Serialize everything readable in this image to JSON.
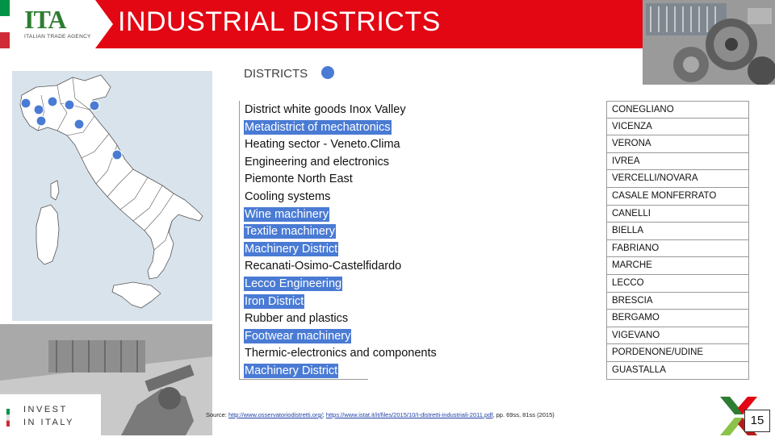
{
  "header": {
    "logo_main": "ITA",
    "logo_sub": "ITALIAN TRADE AGENCY",
    "title": "INDUSTRIAL DISTRICTS"
  },
  "legend": {
    "label": "DISTRICTS",
    "dot_color": "#4a7bd4"
  },
  "table": {
    "rows": [
      {
        "district": "District white goods Inox Valley",
        "city": "CONEGLIANO",
        "highlight": false
      },
      {
        "district": "Metadistrict of mechatronics",
        "city": "VICENZA",
        "highlight": true
      },
      {
        "district": "Heating sector - Veneto.Clima",
        "city": "VERONA",
        "highlight": false
      },
      {
        "district": "Engineering and electronics",
        "city": "IVREA",
        "highlight": false
      },
      {
        "district": "Piemonte North East",
        "city": "VERCELLI/NOVARA",
        "highlight": false
      },
      {
        "district": "Cooling systems",
        "city": "CASALE MONFERRATO",
        "highlight": false
      },
      {
        "district": "Wine machinery",
        "city": "CANELLI",
        "highlight": true
      },
      {
        "district": "Textile machinery",
        "city": "BIELLA",
        "highlight": true
      },
      {
        "district": "Machinery District",
        "city": "FABRIANO",
        "highlight": true
      },
      {
        "district": "Recanati-Osimo-Castelfidardo",
        "city": "MARCHE",
        "highlight": false
      },
      {
        "district": "Lecco Engineering",
        "city": "LECCO",
        "highlight": true
      },
      {
        "district": "Iron District",
        "city": "BRESCIA",
        "highlight": true
      },
      {
        "district": "Rubber and plastics",
        "city": "BERGAMO",
        "highlight": false
      },
      {
        "district": "Footwear machinery",
        "city": "VIGEVANO",
        "highlight": true
      },
      {
        "district": "Thermic-electronics and components",
        "city": "PORDENONE/UDINE",
        "highlight": false
      },
      {
        "district": "Machinery District",
        "city": "GUASTALLA",
        "highlight": true
      }
    ]
  },
  "invest": {
    "line1": "INVEST",
    "line2": "IN ITALY"
  },
  "source": {
    "prefix": "Source: ",
    "link1": "http://www.osservatoriodistretti.org/",
    "sep": "; ",
    "link2": "https://www.istat.it/it/files/2015/10/I-distretti-industriali-2011.pdf",
    "suffix": ", pp. 69ss, 81ss (2015)"
  },
  "page_number": "15",
  "colors": {
    "brand_red": "#e30613",
    "highlight_blue": "#4a7bd4",
    "brand_green": "#2e7d32"
  }
}
